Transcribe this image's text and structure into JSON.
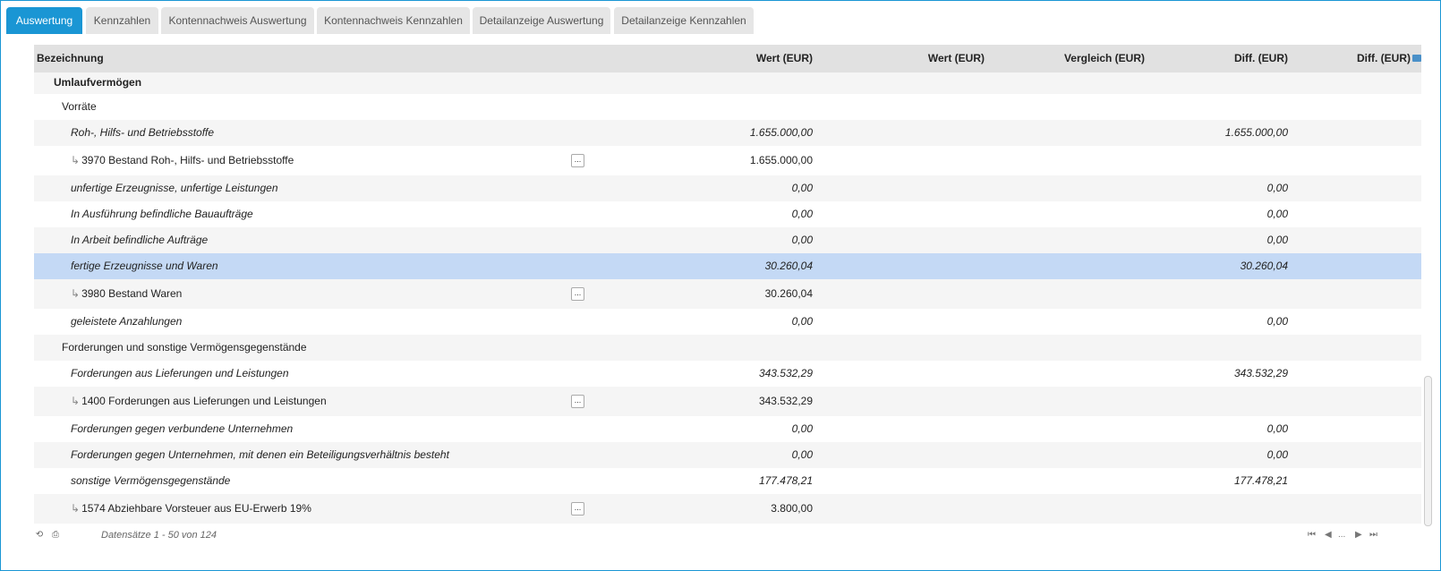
{
  "tabs": [
    {
      "label": "Auswertung",
      "active": true
    },
    {
      "label": "Kennzahlen",
      "active": false
    },
    {
      "label": "Kontennachweis Auswertung",
      "active": false
    },
    {
      "label": "Kontennachweis Kennzahlen",
      "active": false
    },
    {
      "label": "Detailanzeige Auswertung",
      "active": false
    },
    {
      "label": "Detailanzeige Kennzahlen",
      "active": false
    }
  ],
  "columns": {
    "name": "Bezeichnung",
    "value1": "Wert (EUR)",
    "value2": "Wert (EUR)",
    "compare": "Vergleich (EUR)",
    "diff1": "Diff. (EUR)",
    "diff2": "Diff. (EUR)"
  },
  "rows": [
    {
      "name": "Umlaufvermögen",
      "v1": "",
      "d1": ""
    },
    {
      "name": "Vorräte",
      "v1": "",
      "d1": ""
    },
    {
      "name": "Roh-, Hilfs- und Betriebsstoffe",
      "v1": "1.655.000,00",
      "d1": "1.655.000,00"
    },
    {
      "name": "3970 Bestand Roh-, Hilfs- und Betriebsstoffe",
      "v1": "1.655.000,00",
      "d1": "",
      "button": "..."
    },
    {
      "name": "unfertige Erzeugnisse, unfertige Leistungen",
      "v1": "0,00",
      "d1": "0,00"
    },
    {
      "name": "In Ausführung befindliche Bauaufträge",
      "v1": "0,00",
      "d1": "0,00"
    },
    {
      "name": "In Arbeit befindliche Aufträge",
      "v1": "0,00",
      "d1": "0,00"
    },
    {
      "name": "fertige Erzeugnisse und Waren",
      "v1": "30.260,04",
      "d1": "30.260,04"
    },
    {
      "name": "3980 Bestand Waren",
      "v1": "30.260,04",
      "d1": "",
      "button": "..."
    },
    {
      "name": "geleistete Anzahlungen",
      "v1": "0,00",
      "d1": "0,00"
    },
    {
      "name": "Forderungen und sonstige Vermögensgegenstände",
      "v1": "",
      "d1": ""
    },
    {
      "name": "Forderungen aus Lieferungen und Leistungen",
      "v1": "343.532,29",
      "d1": "343.532,29"
    },
    {
      "name": "1400 Forderungen aus Lieferungen und Leistungen",
      "v1": "343.532,29",
      "d1": "",
      "button": "..."
    },
    {
      "name": "Forderungen gegen verbundene Unternehmen",
      "v1": "0,00",
      "d1": "0,00"
    },
    {
      "name": "Forderungen gegen Unternehmen, mit denen ein Beteiligungsverhältnis besteht",
      "v1": "0,00",
      "d1": "0,00"
    },
    {
      "name": "sonstige Vermögensgegenstände",
      "v1": "177.478,21",
      "d1": "177.478,21"
    },
    {
      "name": "1574 Abziehbare Vorsteuer aus EU-Erwerb 19%",
      "v1": "3.800,00",
      "d1": "",
      "button": "..."
    }
  ],
  "footer": {
    "records": "Datensätze 1 - 50 von 124",
    "pager_ellipsis": "..."
  },
  "icons": {
    "refresh": "refresh-icon",
    "print": "print-icon",
    "column_chooser": "column-chooser-icon"
  },
  "colors": {
    "accent": "#1a96d4",
    "selected_row": "#c4d9f5"
  }
}
